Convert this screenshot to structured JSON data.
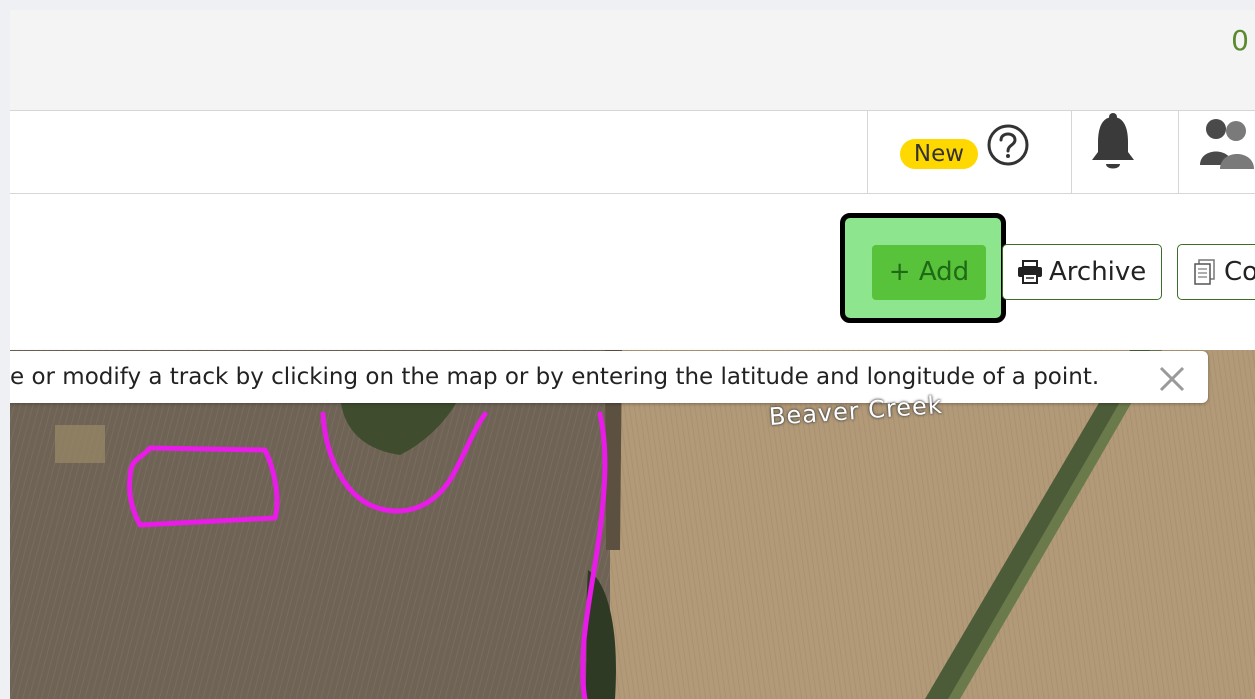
{
  "topbar": {
    "stat_text": "0"
  },
  "navbar": {
    "new_badge": "New",
    "icons": [
      "help-icon",
      "bell-icon",
      "users-icon"
    ]
  },
  "toolbar": {
    "add_label": "+ Add",
    "archive_label": "Archive",
    "copy_label": "Co",
    "icons": [
      "printer-icon",
      "document-icon"
    ]
  },
  "map": {
    "hint_text": "e or modify a track by clicking on the map or by entering the latitude and longitude of a point.",
    "place_label": "Beaver Creek",
    "track_color": "#e81be8"
  },
  "colors": {
    "accent_green": "#58c23b",
    "highlight_green": "#8de58d",
    "badge_yellow": "#ffd800"
  }
}
